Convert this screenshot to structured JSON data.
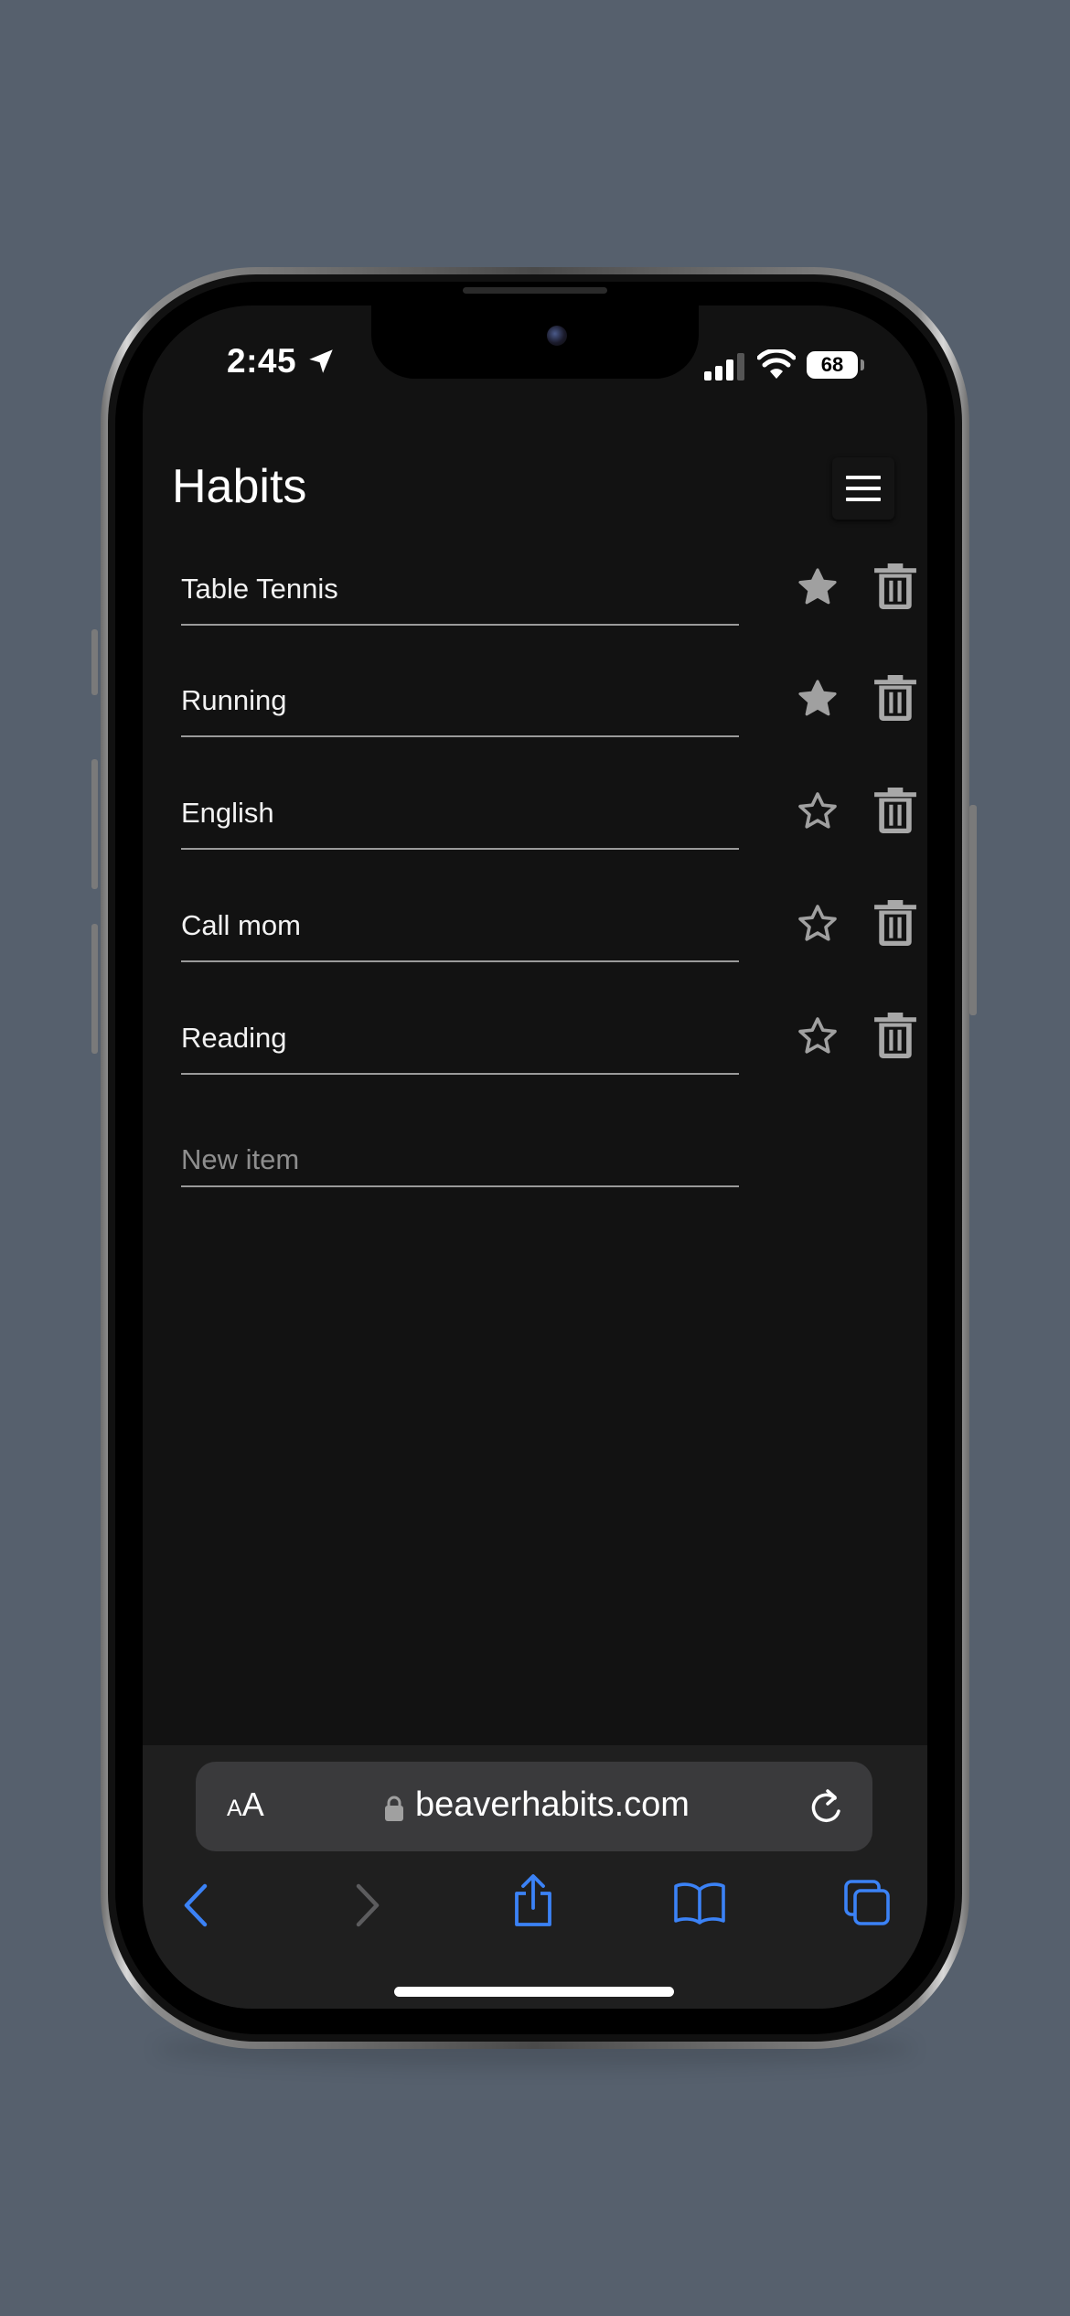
{
  "status_bar": {
    "time": "2:45",
    "battery": "68",
    "icons": [
      "location-arrow-icon",
      "cellular-signal-icon",
      "wifi-icon",
      "battery-icon"
    ]
  },
  "app": {
    "title": "Habits",
    "menu_icon": "hamburger-menu-icon",
    "habits": [
      {
        "name": "Table Tennis",
        "starred": true
      },
      {
        "name": "Running",
        "starred": true
      },
      {
        "name": "English",
        "starred": false
      },
      {
        "name": "Call mom",
        "starred": false
      },
      {
        "name": "Reading",
        "starred": false
      }
    ],
    "new_item": {
      "value": "",
      "placeholder": "New item"
    }
  },
  "safari": {
    "text_size_label_small": "A",
    "text_size_label_large": "A",
    "url": "beaverhabits.com",
    "icons": [
      "lock-icon",
      "reload-icon",
      "back-icon",
      "forward-icon",
      "share-icon",
      "bookmarks-icon",
      "tabs-icon"
    ]
  },
  "colors": {
    "page_background": "#56606d",
    "app_background": "#121212",
    "star_filled": "#9e9e9e",
    "safari_blue": "#3b82f6"
  }
}
